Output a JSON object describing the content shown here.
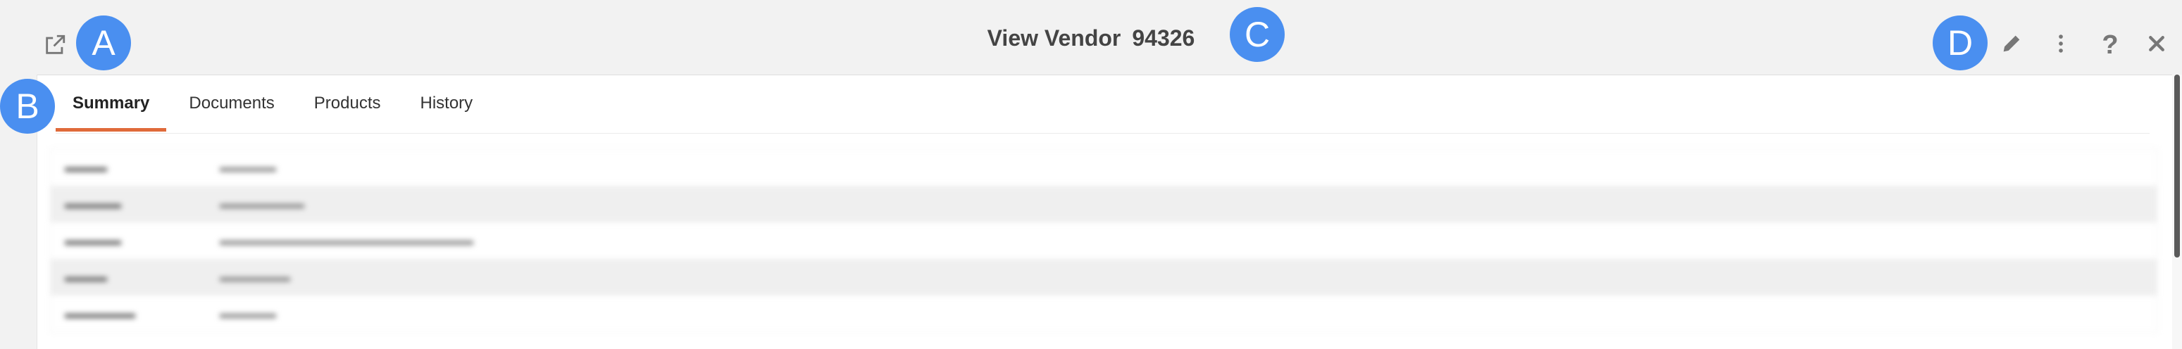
{
  "header": {
    "title": "View Vendor",
    "vendor_id": "94326",
    "icons": {
      "open_external": "open-in-new-window-icon",
      "edit": "pencil-icon",
      "more": "vertical-ellipsis-icon",
      "help": "question-mark-icon",
      "close": "close-x-icon"
    }
  },
  "markers": {
    "a": "A",
    "b": "B",
    "c": "C",
    "d": "D"
  },
  "tabs": [
    {
      "label": "Summary",
      "active": true
    },
    {
      "label": "Documents",
      "active": false
    },
    {
      "label": "Products",
      "active": false
    },
    {
      "label": "History",
      "active": false
    }
  ],
  "colors": {
    "accent_tab_underline": "#e06a3a",
    "marker_blue": "#4a8ff0",
    "background": "#f2f2f2"
  }
}
